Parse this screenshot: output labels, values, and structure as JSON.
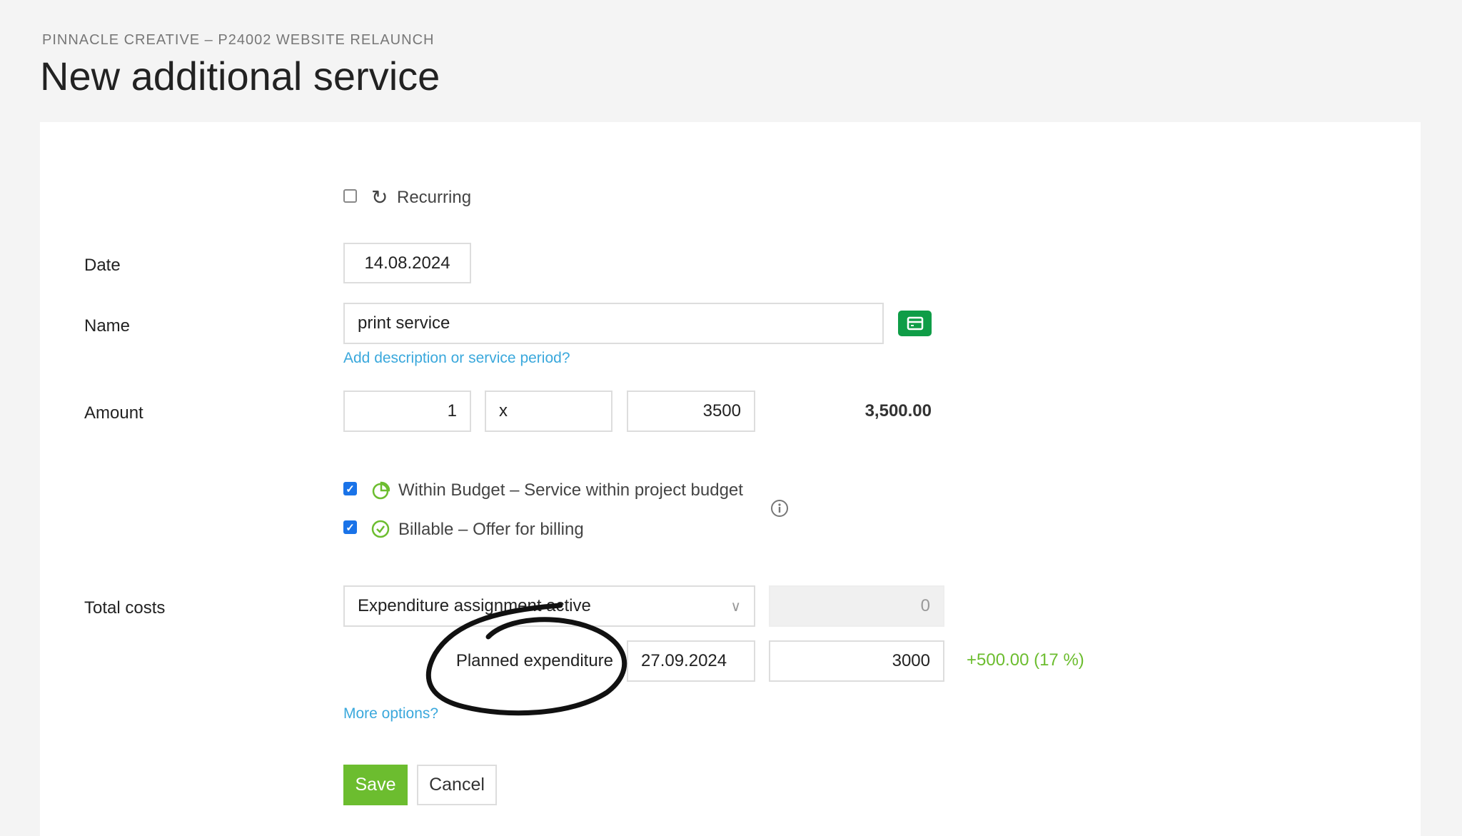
{
  "header": {
    "breadcrumb": "PINNACLE CREATIVE – P24002 WEBSITE RELAUNCH",
    "title": "New additional service"
  },
  "form": {
    "recurring": {
      "label": "Recurring",
      "checked": false,
      "icon": "refresh-icon"
    },
    "date": {
      "label": "Date",
      "value": "14.08.2024"
    },
    "name": {
      "label": "Name",
      "value": "print service",
      "button_icon": "card-icon",
      "add_description_link": "Add description or service period?"
    },
    "amount": {
      "label": "Amount",
      "quantity": "1",
      "unit": "x",
      "price": "3500",
      "total": "3,500.00"
    },
    "within_budget": {
      "label": "Within Budget – Service within project budget",
      "checked": true
    },
    "billable": {
      "label": "Billable – Offer for billing",
      "checked": true
    },
    "total_costs": {
      "label": "Total costs",
      "select_value": "Expenditure assignment active",
      "cost_value": "0",
      "planned_label": "Planned expenditure",
      "planned_date": "27.09.2024",
      "planned_value": "3000",
      "difference": "+500.00 (17 %)"
    },
    "more_options": "More options?",
    "save": "Save",
    "cancel": "Cancel"
  },
  "colors": {
    "accent_green": "#6cbd2f",
    "link_blue": "#3aa8dc",
    "icon_green": "#0f9d47"
  }
}
